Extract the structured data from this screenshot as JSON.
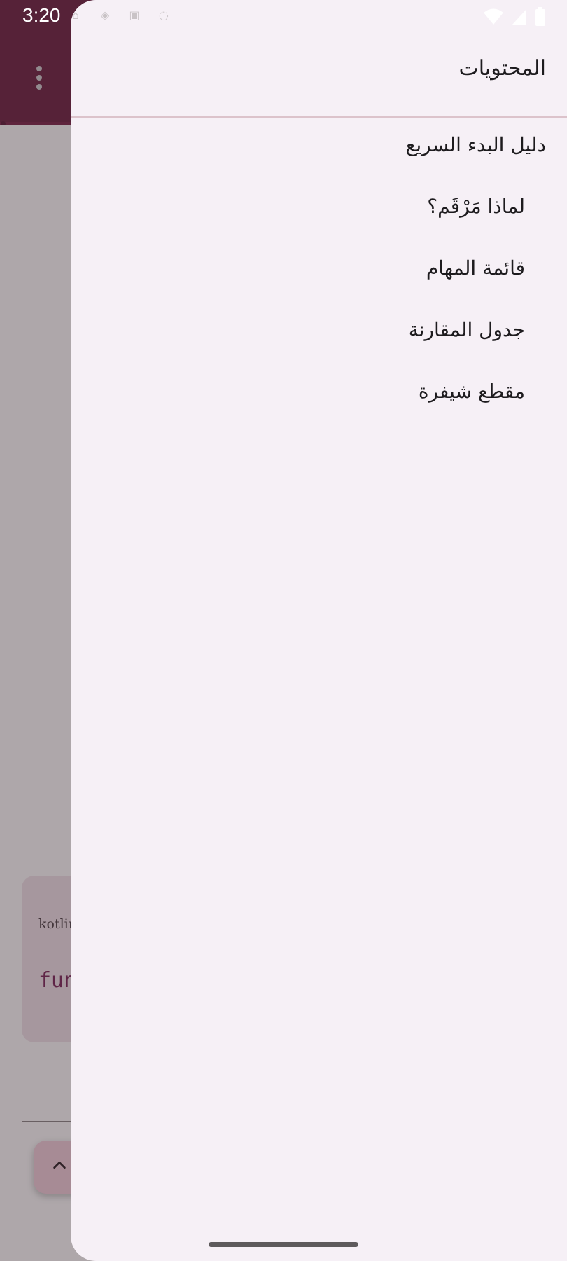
{
  "status_bar": {
    "time": "3:20"
  },
  "background": {
    "code_language": "kotlin",
    "code_snippet": "fun"
  },
  "drawer": {
    "title": "المحتويات",
    "items": [
      {
        "label": "دليل البدء السريع",
        "level": 1
      },
      {
        "label": "لماذا مَرْقَم؟",
        "level": 2
      },
      {
        "label": "قائمة المهام",
        "level": 2
      },
      {
        "label": "جدول المقارنة",
        "level": 2
      },
      {
        "label": "مقطع شيفرة",
        "level": 2
      }
    ]
  },
  "colors": {
    "app_bar": "#6b1a3d",
    "drawer_background": "#f6f0f6",
    "divider": "#dcc3cb"
  }
}
